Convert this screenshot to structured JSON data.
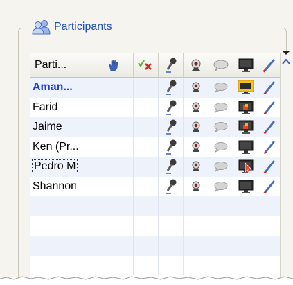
{
  "panel": {
    "title": "Participants",
    "icon": "participants-icon"
  },
  "columns": [
    {
      "label": "Parti...",
      "icon": null
    },
    {
      "label": "",
      "icon": "raise-hand-icon"
    },
    {
      "label": "",
      "icon": "approve-deny-icon"
    },
    {
      "label": "",
      "icon": "microphone-icon"
    },
    {
      "label": "",
      "icon": "webcam-icon"
    },
    {
      "label": "",
      "icon": "chat-icon"
    },
    {
      "label": "",
      "icon": "screen-share-icon"
    },
    {
      "label": "",
      "icon": "annotate-pen-icon"
    }
  ],
  "participants": [
    {
      "name": "Aman...",
      "is_me": true,
      "screen_state": "highlighted"
    },
    {
      "name": "Farid",
      "is_me": false,
      "screen_state": "presenting"
    },
    {
      "name": "Jaime",
      "is_me": false,
      "screen_state": "presenting"
    },
    {
      "name": "Ken (Pr...",
      "is_me": false,
      "screen_state": "normal"
    },
    {
      "name": "Pedro M",
      "is_me": false,
      "focused": true,
      "screen_state": "pointer"
    },
    {
      "name": "Shannon",
      "is_me": false,
      "screen_state": "normal"
    }
  ],
  "empty_rows": 4,
  "colors": {
    "title": "#1f4fb5",
    "me_name": "#1c3fd8",
    "row_alt": "#eef3fb",
    "grid_border": "#7f9db9"
  }
}
